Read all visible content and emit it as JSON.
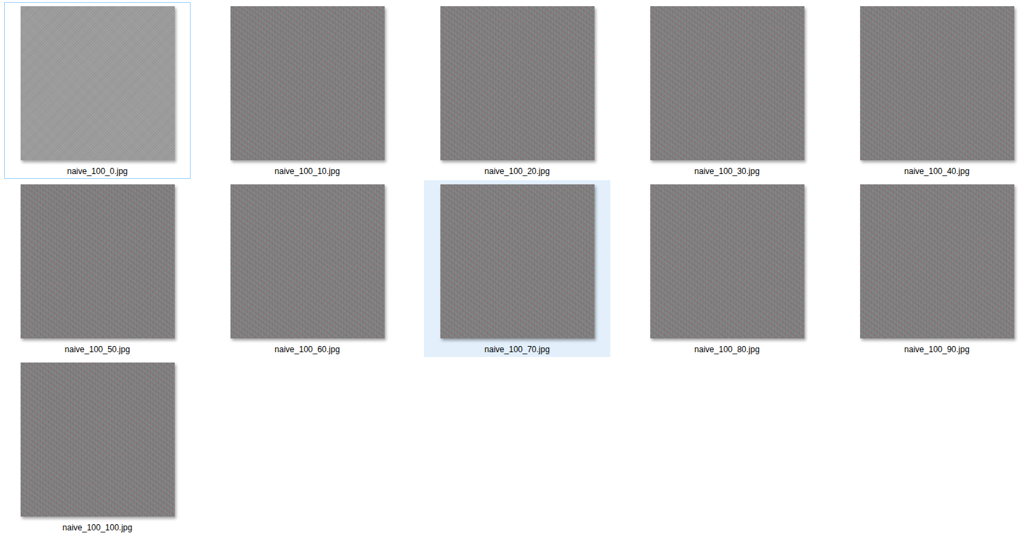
{
  "files": [
    {
      "name": "naive_100_0.jpg",
      "selected": false,
      "focused": true
    },
    {
      "name": "naive_100_10.jpg",
      "selected": false,
      "focused": false
    },
    {
      "name": "naive_100_20.jpg",
      "selected": false,
      "focused": false
    },
    {
      "name": "naive_100_30.jpg",
      "selected": false,
      "focused": false
    },
    {
      "name": "naive_100_40.jpg",
      "selected": false,
      "focused": false
    },
    {
      "name": "naive_100_50.jpg",
      "selected": false,
      "focused": false
    },
    {
      "name": "naive_100_60.jpg",
      "selected": false,
      "focused": false
    },
    {
      "name": "naive_100_70.jpg",
      "selected": true,
      "focused": false
    },
    {
      "name": "naive_100_80.jpg",
      "selected": false,
      "focused": false
    },
    {
      "name": "naive_100_90.jpg",
      "selected": false,
      "focused": false
    },
    {
      "name": "naive_100_100.jpg",
      "selected": false,
      "focused": false
    }
  ]
}
